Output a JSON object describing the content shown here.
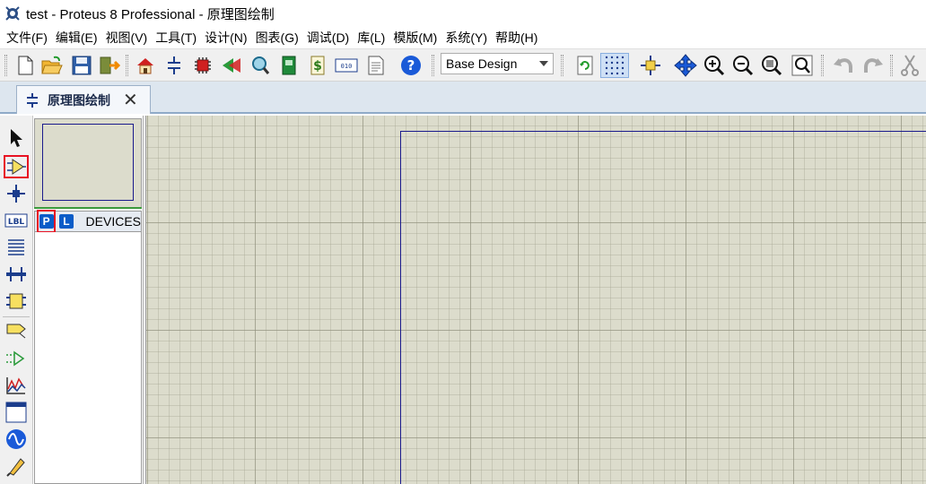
{
  "window": {
    "title": "test - Proteus 8 Professional - 原理图绘制"
  },
  "menu": {
    "items": [
      {
        "label": "文件(F)"
      },
      {
        "label": "编辑(E)"
      },
      {
        "label": "视图(V)"
      },
      {
        "label": "工具(T)"
      },
      {
        "label": "设计(N)"
      },
      {
        "label": "图表(G)"
      },
      {
        "label": "调试(D)"
      },
      {
        "label": "库(L)"
      },
      {
        "label": "模版(M)"
      },
      {
        "label": "系统(Y)"
      },
      {
        "label": "帮助(H)"
      }
    ]
  },
  "toolbar": {
    "design_select_value": "Base Design",
    "grid_toggle_active": true
  },
  "tab": {
    "label": "原理图绘制",
    "close_glyph": "✕"
  },
  "device_panel": {
    "p_button": "P",
    "l_button": "L",
    "title": "DEVICES",
    "items": []
  },
  "mode_toolbar": {
    "selected": "component-mode"
  },
  "colors": {
    "canvas_bg": "#dcdccc",
    "sheet_border": "#1a1a8c",
    "selection_highlight": "#e81123",
    "accent_blue": "#0a5cc8"
  }
}
